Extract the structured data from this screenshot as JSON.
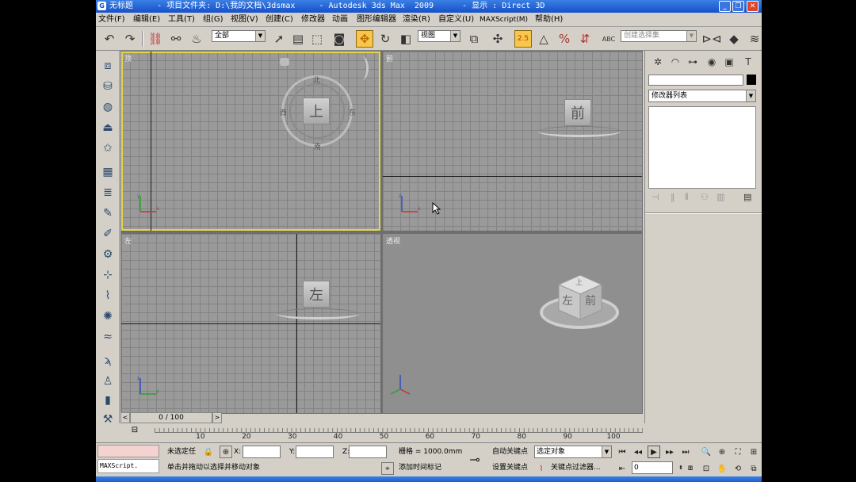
{
  "window": {
    "title": "无标题     - 项目文件夹: D:\\我的文档\\3dsmax     - Autodesk 3ds Max  2009      - 显示 : Direct 3D",
    "app_icon": "G",
    "min_label": "_",
    "max_label": "❐",
    "close_label": "✕"
  },
  "menu": [
    "文件(F)",
    "编辑(E)",
    "工具(T)",
    "组(G)",
    "视图(V)",
    "创建(C)",
    "修改器",
    "动画",
    "图形编辑器",
    "渲染(R)",
    "自定义(U)",
    "MAXScript(M)",
    "帮助(H)"
  ],
  "toolbar": {
    "selection_filter": "全部",
    "ref_coord": "视图",
    "named_selection": "创建选择集",
    "snap_label": "2.5",
    "abc_label": "ABC"
  },
  "viewports": {
    "top": {
      "label": "顶",
      "cube": "上",
      "n": "北",
      "s": "南",
      "e": "东",
      "w": "西"
    },
    "front": {
      "label": "前",
      "cube": "前"
    },
    "left": {
      "label": "左",
      "cube": "左"
    },
    "persp": {
      "label": "透视",
      "cube_left": "左",
      "cube_front": "前",
      "cube_top": "上"
    }
  },
  "command_panel": {
    "modifier_list": "修改器列表"
  },
  "timeline": {
    "frame": "0 / 100",
    "ticks": [
      "10",
      "20",
      "30",
      "40",
      "50",
      "60",
      "70",
      "80",
      "90",
      "100"
    ]
  },
  "status": {
    "selection": "未选定任",
    "x_label": "X:",
    "y_label": "Y:",
    "z_label": "Z:",
    "grid": "栅格 = 1000.0mm",
    "prompt": "单击并拖动以选择并移动对象",
    "add_time_tag": "添加时间标记",
    "auto_key": "自动关键点",
    "set_key": "设置关键点",
    "selected_object": "选定对象",
    "key_filters": "关键点过滤器...",
    "frame_value": "0",
    "maxscript": "MAXScript."
  }
}
